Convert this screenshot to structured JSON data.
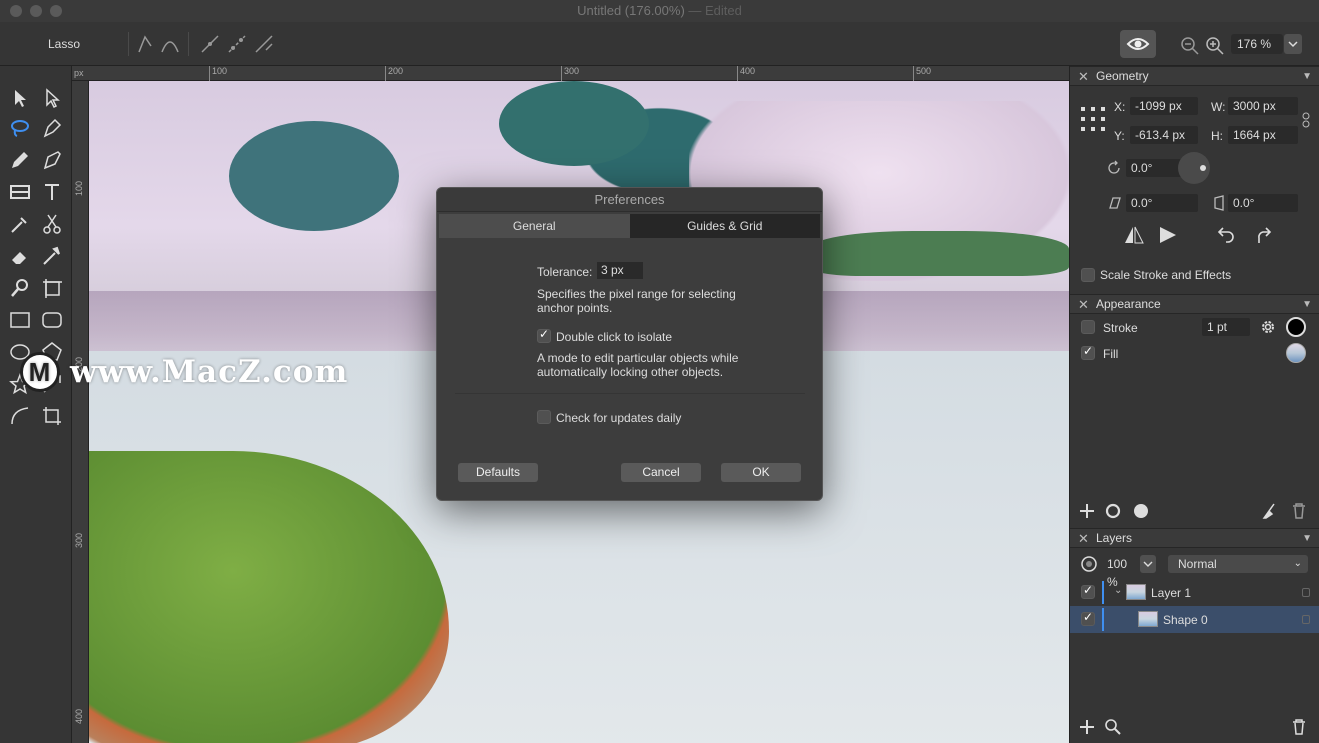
{
  "window": {
    "title": "Untitled (176.00%)",
    "edited": " — Edited"
  },
  "toolbar": {
    "tool_name": "Lasso",
    "zoom": "176 %"
  },
  "ruler": {
    "unit": "px",
    "top_ticks": [
      "100",
      "200",
      "300",
      "400",
      "500"
    ],
    "left_ticks": [
      "100",
      "200",
      "300",
      "400"
    ]
  },
  "watermark": {
    "logo": "M",
    "text": "www.MacZ.com"
  },
  "geometry": {
    "title": "Geometry",
    "x_label": "X:",
    "x": "-1099 px",
    "y_label": "Y:",
    "y": "-613.4 px",
    "w_label": "W:",
    "w": "3000 px",
    "h_label": "H:",
    "h": "1664 px",
    "rotation": "0.0°",
    "shear": "0.0°",
    "skew": "0.0°",
    "scale_label": "Scale Stroke and Effects"
  },
  "appearance": {
    "title": "Appearance",
    "stroke_label": "Stroke",
    "stroke_width": "1 pt",
    "fill_label": "Fill"
  },
  "layers": {
    "title": "Layers",
    "opacity": "100 %",
    "blend": "Normal",
    "items": [
      {
        "name": "Layer 1"
      },
      {
        "name": "Shape 0"
      }
    ]
  },
  "dialog": {
    "title": "Preferences",
    "tabs": [
      {
        "label": "General"
      },
      {
        "label": "Guides & Grid"
      }
    ],
    "tolerance_label": "Tolerance:",
    "tolerance_value": "3 px",
    "tolerance_desc_1": "Specifies the pixel range for selecting",
    "tolerance_desc_2": "anchor points.",
    "isolate_label": "Double click to isolate",
    "isolate_desc_1": "A mode to edit particular objects while",
    "isolate_desc_2": "automatically locking other objects.",
    "updates_label": "Check for updates daily",
    "defaults": "Defaults",
    "cancel": "Cancel",
    "ok": "OK"
  }
}
